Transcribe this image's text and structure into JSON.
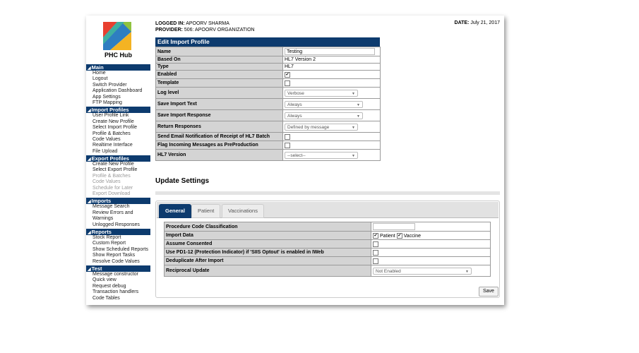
{
  "app": {
    "brand": "PHC Hub"
  },
  "header": {
    "logged_in_label": "LOGGED IN:",
    "logged_in_value": "APOORV SHARMA",
    "provider_label": "PROVIDER:",
    "provider_value": "506: APOORV ORGANIZATION",
    "date_label": "DATE:",
    "date_value": "July 21, 2017"
  },
  "sidebar": [
    {
      "title": "Main",
      "items": [
        "Home",
        "Logout",
        "Switch Provider",
        "Application Dashboard",
        "App Settings",
        "FTP Mapping"
      ]
    },
    {
      "title": "Import Profiles",
      "items": [
        "User Profile Link",
        "Create New Profile",
        "Select Import Profile",
        "Profile & Batches",
        "Code Values",
        "Realtime Interface",
        "File Upload"
      ]
    },
    {
      "title": "Export Profiles",
      "items": [
        "Create New Profile",
        "Select Export Profile",
        "Profile & Batches",
        "Code Values",
        "Schedule for Later",
        "Export Download"
      ],
      "disabled_from": 2
    },
    {
      "title": "Imports",
      "items": [
        "Message Search",
        "Review Errors and",
        "Warnings",
        "Unlogged Responses"
      ]
    },
    {
      "title": "Reports",
      "items": [
        "Stock Report",
        "Custom Report",
        "Show Scheduled Reports",
        "Show Report Tasks",
        "Resolve Code Values"
      ]
    },
    {
      "title": "Test",
      "items": [
        "Message constructor",
        "Quick view",
        "Request debug",
        "Transaction handlers",
        "Code Tables"
      ]
    }
  ],
  "edit": {
    "title": "Edit Import Profile",
    "rows": {
      "name": {
        "label": "Name",
        "value": "Testing"
      },
      "based_on": {
        "label": "Based On",
        "value": "HL7 Version 2"
      },
      "type": {
        "label": "Type",
        "value": "HL7"
      },
      "enabled": {
        "label": "Enabled",
        "checked": true
      },
      "template": {
        "label": "Template",
        "checked": false
      },
      "log_level": {
        "label": "Log level",
        "value": "Verbose"
      },
      "save_text": {
        "label": "Save Import Text",
        "value": "Always"
      },
      "save_response": {
        "label": "Save Import Response",
        "value": "Always"
      },
      "return_responses": {
        "label": "Return Responses",
        "value": "Defined by message"
      },
      "send_email": {
        "label": "Send Email Notification of Receipt of HL7 Batch",
        "checked": false
      },
      "flag_preprod": {
        "label": "Flag Incoming Messages as PreProduction",
        "checked": false
      },
      "hl7_version": {
        "label": "HL7 Version",
        "value": "--select--"
      }
    }
  },
  "update": {
    "title": "Update Settings",
    "tabs": [
      "General",
      "Patient",
      "Vaccinations"
    ],
    "rows": {
      "proc_code": {
        "label": "Procedure Code Classification",
        "value": ""
      },
      "import_data": {
        "label": "Import Data",
        "opt1": "Patient",
        "opt2": "Vaccine"
      },
      "assume": {
        "label": "Assume Consented"
      },
      "pd1": {
        "label": "Use PD1-12 (Protection Indicator) if 'SIIS Optout' is enabled in IWeb"
      },
      "dedupe": {
        "label": "Deduplicate After Import"
      },
      "reciprocal": {
        "label": "Reciprocal Update",
        "value": "Not Enabled"
      }
    },
    "save_label": "Save"
  },
  "colors": {
    "accent": "#0d3b6e",
    "label_bg": "#d4d4d4"
  }
}
